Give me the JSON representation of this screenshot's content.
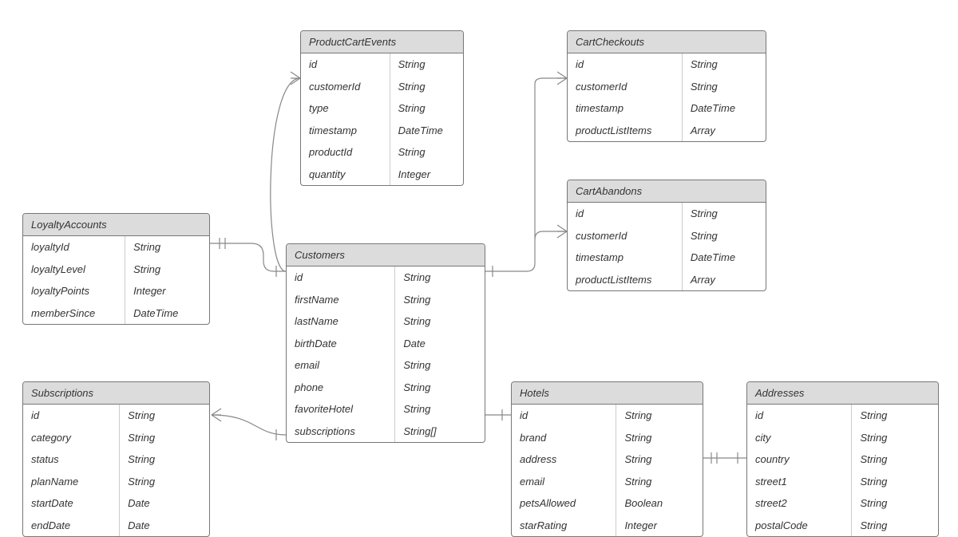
{
  "entities": {
    "productCartEvents": {
      "title": "ProductCartEvents",
      "rows": [
        {
          "name": "id",
          "type": "String"
        },
        {
          "name": "customerId",
          "type": "String"
        },
        {
          "name": "type",
          "type": "String"
        },
        {
          "name": "timestamp",
          "type": "DateTime"
        },
        {
          "name": "productId",
          "type": "String"
        },
        {
          "name": "quantity",
          "type": "Integer"
        }
      ]
    },
    "cartCheckouts": {
      "title": "CartCheckouts",
      "rows": [
        {
          "name": "id",
          "type": "String"
        },
        {
          "name": "customerId",
          "type": "String"
        },
        {
          "name": "timestamp",
          "type": "DateTime"
        },
        {
          "name": "productListItems",
          "type": "Array"
        }
      ]
    },
    "cartAbandons": {
      "title": "CartAbandons",
      "rows": [
        {
          "name": "id",
          "type": "String"
        },
        {
          "name": "customerId",
          "type": "String"
        },
        {
          "name": "timestamp",
          "type": "DateTime"
        },
        {
          "name": "productListItems",
          "type": "Array"
        }
      ]
    },
    "loyaltyAccounts": {
      "title": "LoyaltyAccounts",
      "rows": [
        {
          "name": "loyaltyId",
          "type": "String"
        },
        {
          "name": "loyaltyLevel",
          "type": "String"
        },
        {
          "name": "loyaltyPoints",
          "type": "Integer"
        },
        {
          "name": "memberSince",
          "type": "DateTime"
        }
      ]
    },
    "customers": {
      "title": "Customers",
      "rows": [
        {
          "name": "id",
          "type": "String"
        },
        {
          "name": "firstName",
          "type": "String"
        },
        {
          "name": "lastName",
          "type": "String"
        },
        {
          "name": "birthDate",
          "type": "Date"
        },
        {
          "name": "email",
          "type": "String"
        },
        {
          "name": "phone",
          "type": "String"
        },
        {
          "name": "favoriteHotel",
          "type": "String"
        },
        {
          "name": "subscriptions",
          "type": "String[]"
        }
      ]
    },
    "subscriptions": {
      "title": "Subscriptions",
      "rows": [
        {
          "name": "id",
          "type": "String"
        },
        {
          "name": "category",
          "type": "String"
        },
        {
          "name": "status",
          "type": "String"
        },
        {
          "name": "planName",
          "type": "String"
        },
        {
          "name": "startDate",
          "type": "Date"
        },
        {
          "name": "endDate",
          "type": "Date"
        }
      ]
    },
    "hotels": {
      "title": "Hotels",
      "rows": [
        {
          "name": "id",
          "type": "String"
        },
        {
          "name": "brand",
          "type": "String"
        },
        {
          "name": "address",
          "type": "String"
        },
        {
          "name": "email",
          "type": "String"
        },
        {
          "name": "petsAllowed",
          "type": "Boolean"
        },
        {
          "name": "starRating",
          "type": "Integer"
        }
      ]
    },
    "addresses": {
      "title": "Addresses",
      "rows": [
        {
          "name": "id",
          "type": "String"
        },
        {
          "name": "city",
          "type": "String"
        },
        {
          "name": "country",
          "type": "String"
        },
        {
          "name": "street1",
          "type": "String"
        },
        {
          "name": "street2",
          "type": "String"
        },
        {
          "name": "postalCode",
          "type": "String"
        }
      ]
    }
  }
}
